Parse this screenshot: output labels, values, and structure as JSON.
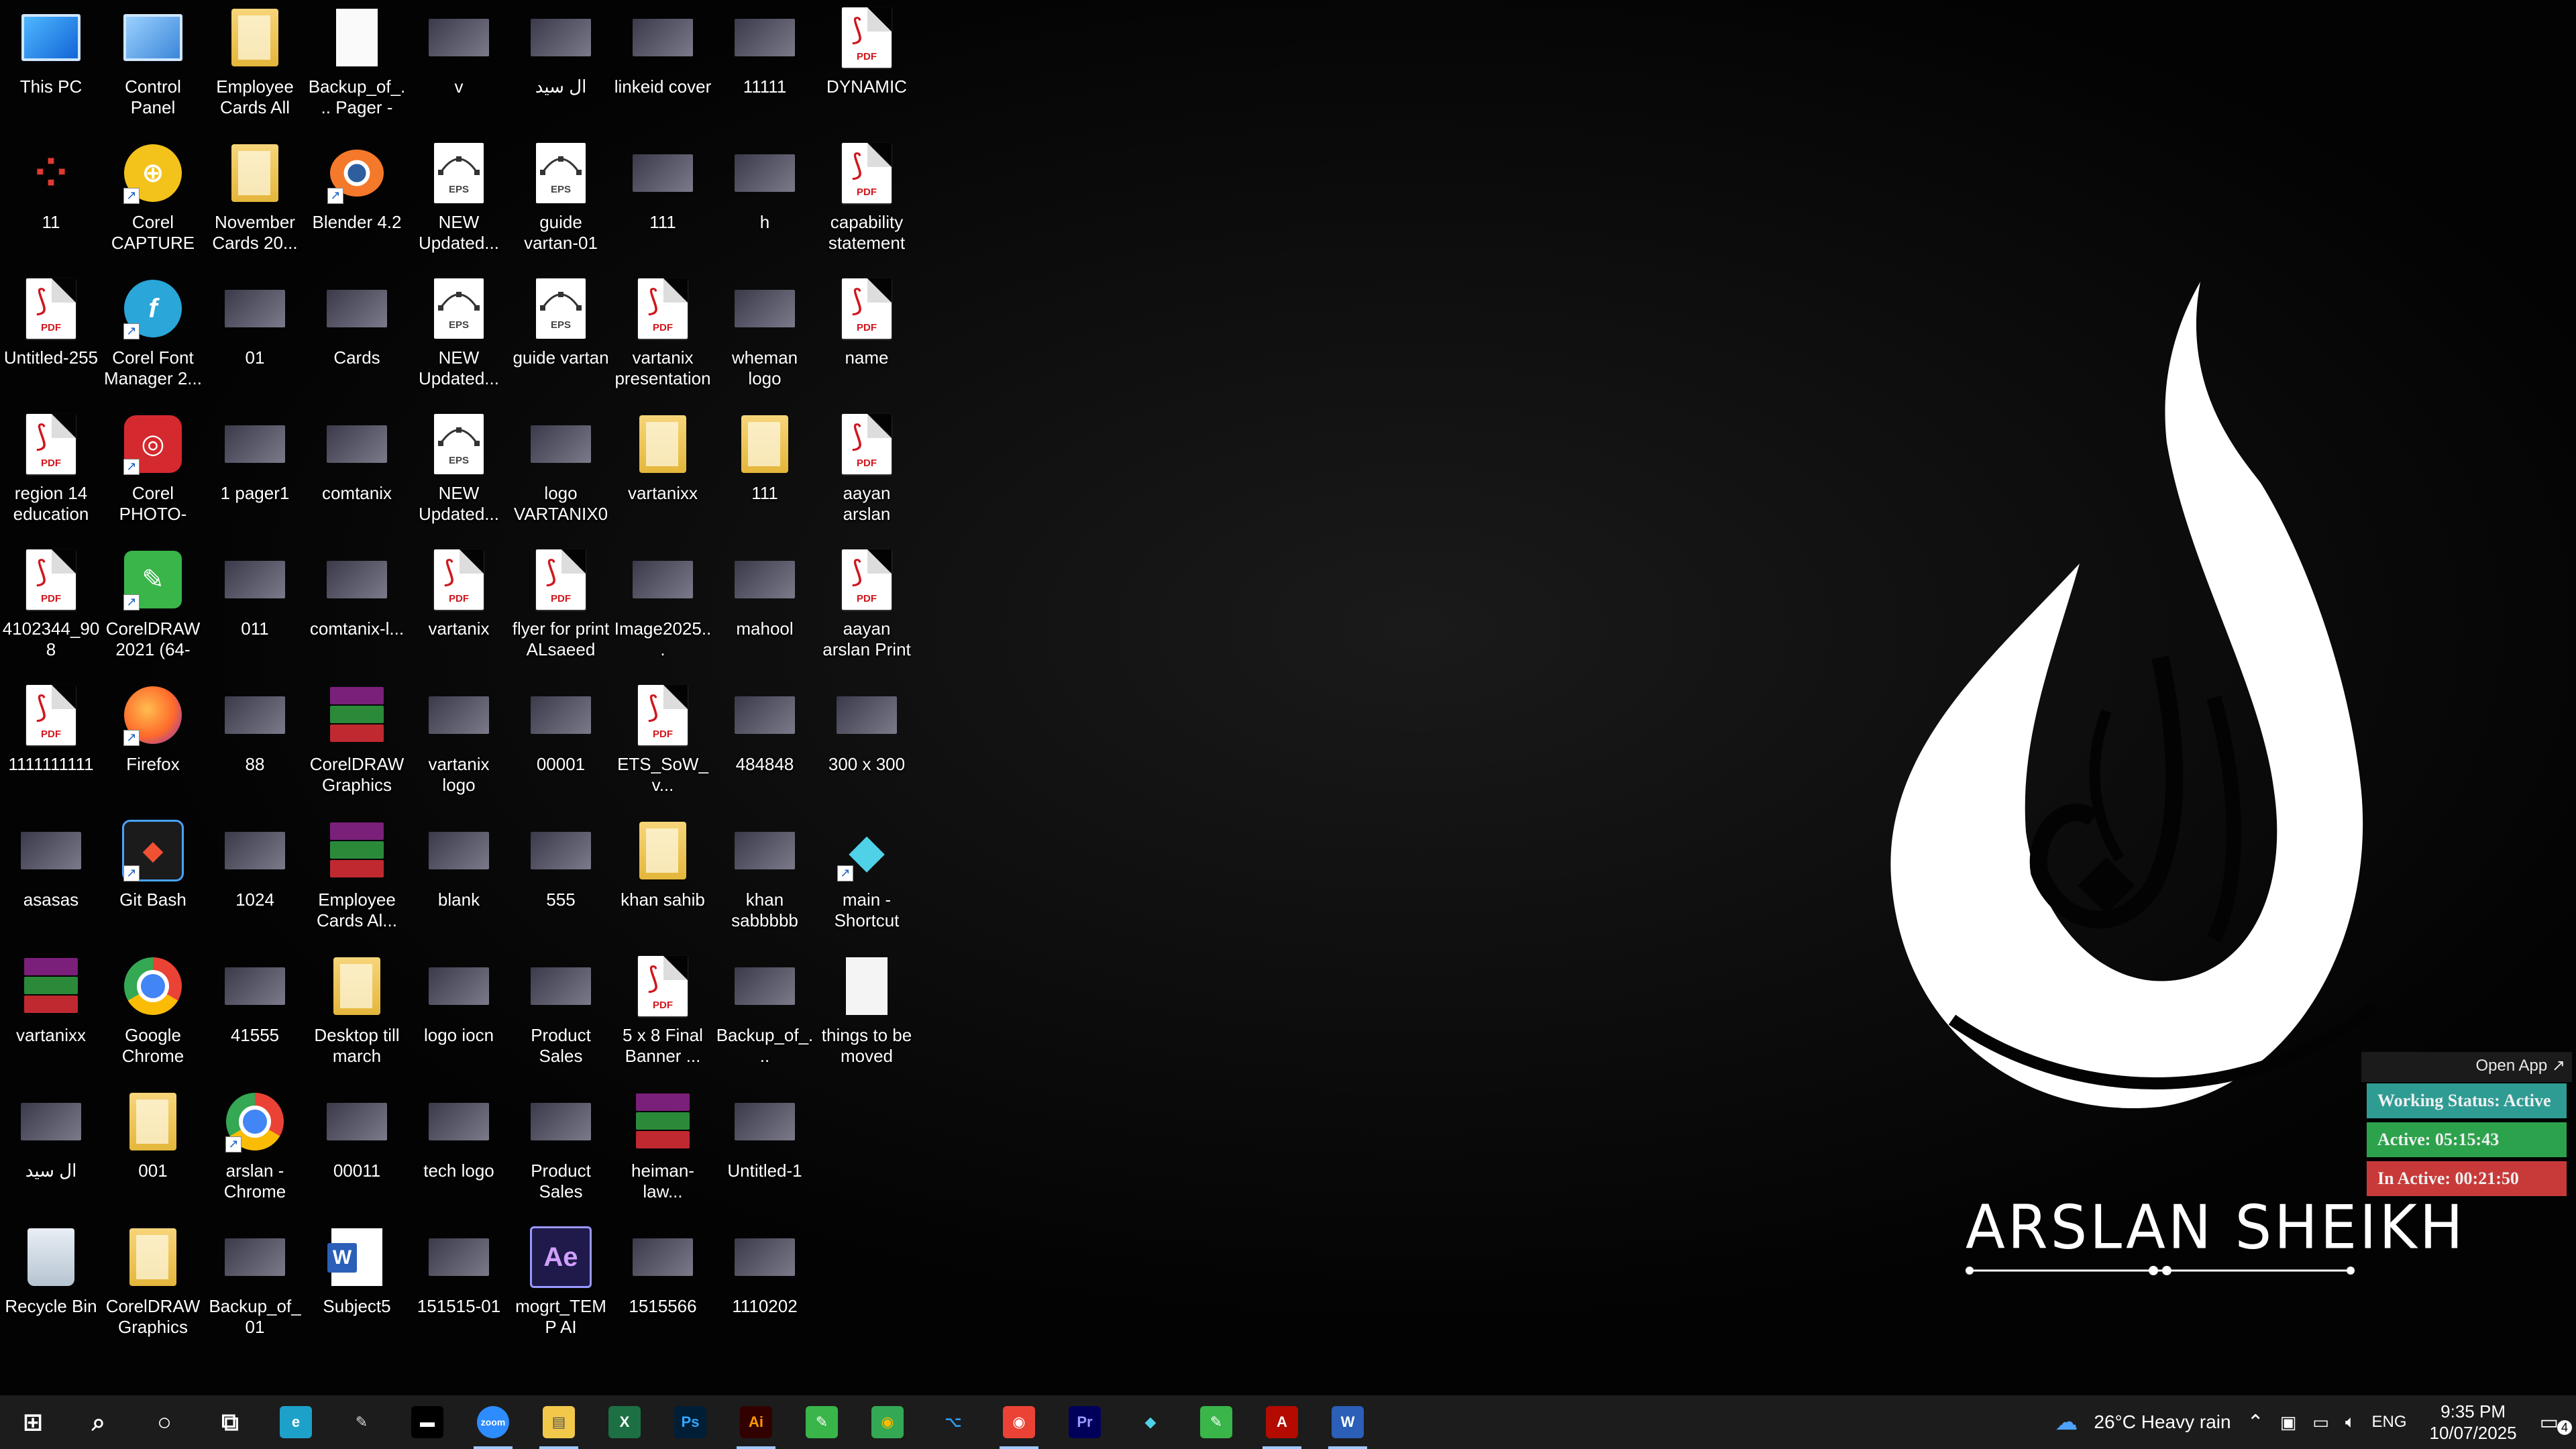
{
  "desktop": {
    "columns": [
      [
        {
          "label": "This PC",
          "icon": "computer-icon",
          "shortcut": false
        },
        {
          "label": "11",
          "icon": "dots-app-icon",
          "shortcut": false
        },
        {
          "label": "Untitled-255",
          "icon": "pdf-icon",
          "shortcut": false
        },
        {
          "label": "region 14 education s...",
          "icon": "pdf-icon",
          "shortcut": false
        },
        {
          "label": "4102344_908",
          "icon": "pdf-icon",
          "shortcut": false
        },
        {
          "label": "1111111111",
          "icon": "pdf-icon",
          "shortcut": false
        },
        {
          "label": "asasas",
          "icon": "image-icon",
          "shortcut": false
        },
        {
          "label": "vartanixx",
          "icon": "winrar-icon",
          "shortcut": false
        },
        {
          "label": "ال سيد",
          "icon": "image-icon",
          "shortcut": false
        },
        {
          "label": "Recycle Bin",
          "icon": "recycle-bin-icon",
          "shortcut": false
        }
      ],
      [
        {
          "label": "Control Panel",
          "icon": "control-panel-icon",
          "shortcut": false
        },
        {
          "label": "Corel CAPTURE 2...",
          "icon": "corel-capture-icon",
          "shortcut": true
        },
        {
          "label": "Corel Font Manager 2...",
          "icon": "corel-font-icon",
          "shortcut": true
        },
        {
          "label": "Corel PHOTO-PAI...",
          "icon": "corel-photopaint-icon",
          "shortcut": true
        },
        {
          "label": "CorelDRAW 2021 (64-Bit)",
          "icon": "coreldraw-icon",
          "shortcut": true
        },
        {
          "label": "Firefox",
          "icon": "firefox-icon",
          "shortcut": true
        },
        {
          "label": "Git Bash",
          "icon": "git-icon",
          "shortcut": true
        },
        {
          "label": "Google Chrome",
          "icon": "chrome-icon",
          "shortcut": false
        },
        {
          "label": "001",
          "icon": "folder-icon",
          "shortcut": false
        },
        {
          "label": "CorelDRAW Graphics Su...",
          "icon": "folder-icon",
          "shortcut": false
        }
      ],
      [
        {
          "label": "Employee Cards All",
          "icon": "folder-icon",
          "shortcut": false
        },
        {
          "label": "November Cards 20...",
          "icon": "folder-icon",
          "shortcut": false
        },
        {
          "label": "01",
          "icon": "image-icon",
          "shortcut": false
        },
        {
          "label": "1 pager1",
          "icon": "image-icon",
          "shortcut": false
        },
        {
          "label": "011",
          "icon": "image-icon",
          "shortcut": false
        },
        {
          "label": "88",
          "icon": "image-icon",
          "shortcut": false
        },
        {
          "label": "1024",
          "icon": "image-icon",
          "shortcut": false
        },
        {
          "label": "41555",
          "icon": "image-icon",
          "shortcut": false
        },
        {
          "label": "arslan - Chrome",
          "icon": "chrome-icon",
          "shortcut": true
        },
        {
          "label": "Backup_of_01",
          "icon": "image-icon",
          "shortcut": false
        }
      ],
      [
        {
          "label": "Backup_of_... Pager - NY...",
          "icon": "document-icon",
          "shortcut": false
        },
        {
          "label": "Blender 4.2",
          "icon": "blender-icon",
          "shortcut": true
        },
        {
          "label": "Cards",
          "icon": "image-icon",
          "shortcut": false
        },
        {
          "label": "comtanix",
          "icon": "image-icon",
          "shortcut": false
        },
        {
          "label": "comtanix-l...",
          "icon": "image-icon",
          "shortcut": false
        },
        {
          "label": "CorelDRAW Graphics Su...",
          "icon": "winrar-icon",
          "shortcut": false
        },
        {
          "label": "Employee Cards Al...",
          "icon": "winrar-icon",
          "shortcut": false
        },
        {
          "label": "Desktop till march",
          "icon": "folder-icon",
          "shortcut": false
        },
        {
          "label": "00011",
          "icon": "image-icon",
          "shortcut": false
        },
        {
          "label": "Subject5",
          "icon": "word-icon",
          "shortcut": false
        }
      ],
      [
        {
          "label": "v",
          "icon": "image-icon",
          "shortcut": false
        },
        {
          "label": "NEW Updated...",
          "icon": "eps-icon",
          "shortcut": false
        },
        {
          "label": "NEW Updated...",
          "icon": "eps-icon",
          "shortcut": false
        },
        {
          "label": "NEW Updated...",
          "icon": "eps-icon",
          "shortcut": false
        },
        {
          "label": "vartanix",
          "icon": "pdf-icon",
          "shortcut": false
        },
        {
          "label": "vartanix logo",
          "icon": "image-icon",
          "shortcut": false
        },
        {
          "label": "blank",
          "icon": "image-icon",
          "shortcut": false
        },
        {
          "label": "logo iocn",
          "icon": "image-icon",
          "shortcut": false
        },
        {
          "label": "tech logo",
          "icon": "image-icon",
          "shortcut": false
        },
        {
          "label": "151515-01",
          "icon": "image-icon",
          "shortcut": false
        }
      ],
      [
        {
          "label": "ال سيد",
          "icon": "image-icon",
          "shortcut": false
        },
        {
          "label": "guide vartan-01",
          "icon": "eps-icon",
          "shortcut": false
        },
        {
          "label": "guide vartan",
          "icon": "eps-icon",
          "shortcut": false
        },
        {
          "label": "logo VARTANIX01",
          "icon": "image-icon",
          "shortcut": false
        },
        {
          "label": "flyer for print ALsaeed po...",
          "icon": "pdf-icon",
          "shortcut": false
        },
        {
          "label": "00001",
          "icon": "image-icon",
          "shortcut": false
        },
        {
          "label": "555",
          "icon": "image-icon",
          "shortcut": false
        },
        {
          "label": "Product Sales Promo Pack...",
          "icon": "image-icon",
          "shortcut": false
        },
        {
          "label": "Product Sales Promo Pack...",
          "icon": "image-icon",
          "shortcut": false
        },
        {
          "label": "mogrt_TEMP AI (convert...",
          "icon": "after-effects-icon",
          "shortcut": false
        }
      ],
      [
        {
          "label": "linkeid cover",
          "icon": "image-icon",
          "shortcut": false
        },
        {
          "label": "111",
          "icon": "image-icon",
          "shortcut": false
        },
        {
          "label": "vartanix presentation",
          "icon": "pdf-icon",
          "shortcut": false
        },
        {
          "label": "vartanixx",
          "icon": "folder-icon",
          "shortcut": false
        },
        {
          "label": "Image2025...",
          "icon": "image-icon",
          "shortcut": false
        },
        {
          "label": "ETS_SoW_v...",
          "icon": "pdf-icon",
          "shortcut": false
        },
        {
          "label": "khan sahib",
          "icon": "folder-icon",
          "shortcut": false
        },
        {
          "label": "5 x 8 Final Banner ...",
          "icon": "pdf-icon",
          "shortcut": false
        },
        {
          "label": "heiman-law...",
          "icon": "winrar-icon",
          "shortcut": false
        },
        {
          "label": "1515566",
          "icon": "image-icon",
          "shortcut": false
        }
      ],
      [
        {
          "label": "11111",
          "icon": "image-icon",
          "shortcut": false
        },
        {
          "label": "h",
          "icon": "image-icon",
          "shortcut": false
        },
        {
          "label": "wheman logo",
          "icon": "image-icon",
          "shortcut": false
        },
        {
          "label": "111",
          "icon": "folder-icon",
          "shortcut": false
        },
        {
          "label": "mahool",
          "icon": "image-icon",
          "shortcut": false
        },
        {
          "label": "484848",
          "icon": "image-icon",
          "shortcut": false
        },
        {
          "label": "khan sabbbbb",
          "icon": "image-icon",
          "shortcut": false
        },
        {
          "label": "Backup_of_...",
          "icon": "image-icon",
          "shortcut": false
        },
        {
          "label": "Untitled-1",
          "icon": "image-icon",
          "shortcut": false
        },
        {
          "label": "1110202",
          "icon": "image-icon",
          "shortcut": false
        }
      ],
      [
        {
          "label": "DYNAMIC",
          "icon": "pdf-icon",
          "shortcut": false
        },
        {
          "label": "capability statement",
          "icon": "pdf-icon",
          "shortcut": false
        },
        {
          "label": "name",
          "icon": "pdf-icon",
          "shortcut": false
        },
        {
          "label": "aayan arslan",
          "icon": "pdf-icon",
          "shortcut": false
        },
        {
          "label": "aayan arslan Print",
          "icon": "pdf-icon",
          "shortcut": false
        },
        {
          "label": "300 x 300",
          "icon": "image-icon",
          "shortcut": false
        },
        {
          "label": "main - Shortcut",
          "icon": "app-shortcut-icon",
          "shortcut": true
        },
        {
          "label": "things to be moved",
          "icon": "blank-document-icon",
          "shortcut": false
        }
      ]
    ]
  },
  "brand": {
    "name": "ARSLAN SHEIKH"
  },
  "status_widget": {
    "open_app": "Open App ↗",
    "working": "Working Status: Active",
    "active": "Active: 05:15:43",
    "inactive": "In Active: 00:21:50"
  },
  "taskbar": {
    "apps": [
      {
        "name": "start-button",
        "glyph": "⊞"
      },
      {
        "name": "search-button",
        "glyph": "⌕"
      },
      {
        "name": "cortana-button",
        "glyph": "○"
      },
      {
        "name": "task-view-button",
        "glyph": "⧉"
      },
      {
        "name": "edge-app",
        "glyph": "e"
      },
      {
        "name": "pen-app",
        "glyph": "✎"
      },
      {
        "name": "terminal-app",
        "glyph": "▬"
      },
      {
        "name": "zoom-app",
        "glyph": "zoom"
      },
      {
        "name": "file-explorer-app",
        "glyph": "▤"
      },
      {
        "name": "excel-app",
        "glyph": "X"
      },
      {
        "name": "photoshop-app",
        "glyph": "Ps"
      },
      {
        "name": "illustrator-app",
        "glyph": "Ai"
      },
      {
        "name": "coreldraw-app",
        "glyph": "✎"
      },
      {
        "name": "chrome-app",
        "glyph": "◉"
      },
      {
        "name": "vscode-app",
        "glyph": "⌥"
      },
      {
        "name": "chrome-profile-app",
        "glyph": "◉"
      },
      {
        "name": "premiere-app",
        "glyph": "Pr"
      },
      {
        "name": "shortcut-app",
        "glyph": "◆"
      },
      {
        "name": "coreldraw2-app",
        "glyph": "✎"
      },
      {
        "name": "acrobat-app",
        "glyph": "A"
      },
      {
        "name": "word-app",
        "glyph": "W"
      }
    ],
    "weather": "26°C  Heavy rain",
    "lang": "ENG",
    "time": "9:35 PM",
    "date": "10/07/2025",
    "notifications": "4"
  }
}
